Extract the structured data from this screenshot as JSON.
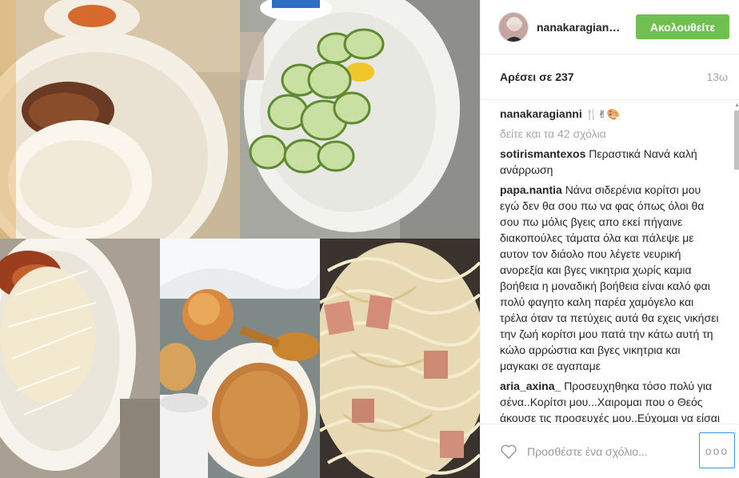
{
  "post": {
    "username": "nanakaragian…",
    "follow_label": "Ακολουθείτε",
    "likes_label": "Αρέσει σε 237",
    "age": "13ω"
  },
  "caption": {
    "user": "nanakaragianni",
    "emoji": "🍴✌🎨"
  },
  "view_all_label": "δείτε και τα 42 σχόλια",
  "comments": [
    {
      "user": "sotirismantexos",
      "text": "Περαστικά Νανά καλή ανάρρωση"
    },
    {
      "user": "papa.nantia",
      "text": "Νάνα σιδερένια κορίτσι μου εγώ δεν θα σου πω να φας όπως όλοι θα σου πω μόλις βγεις απο εκεί πήγαινε διακοπούλες τάματα όλα και πάλεψε με αυτον τον διάολο που λέγετε νευρική ανορεξία και βγες νικητρια χωρίς καμια βοήθεια η μοναδική βοήθεια είναι καλό φαι πολύ φαγητο καλη παρέα χαμόγελο και τρέλα όταν τα πετύχεις αυτά θα εχεις νικήσει την ζωή κορίτσι μου πατά την κάτω αυτή τη κώλο αρρώστια και βγες νικητρια και μαγκακι σε αγαπαμε"
    },
    {
      "user": "aria_axina_",
      "text": "Προσευχηθηκα τόσο πολύ για σένα..Κορίτσι μου...Χαιρομαι που ο Θεός άκουσε τις προσευχές μου..Εύχομαι να είσαι πάντα γερή κ να βγεις νικήτρια από όλο αυτό.Ο θεός να"
    }
  ],
  "footer": {
    "add_comment_placeholder": "Προσθέστε ένα σχόλιο...",
    "more_label": "ooo"
  },
  "colors": {
    "follow_green": "#70c050",
    "muted_gray": "#a5a7aa",
    "focus_blue": "#3897f0"
  }
}
